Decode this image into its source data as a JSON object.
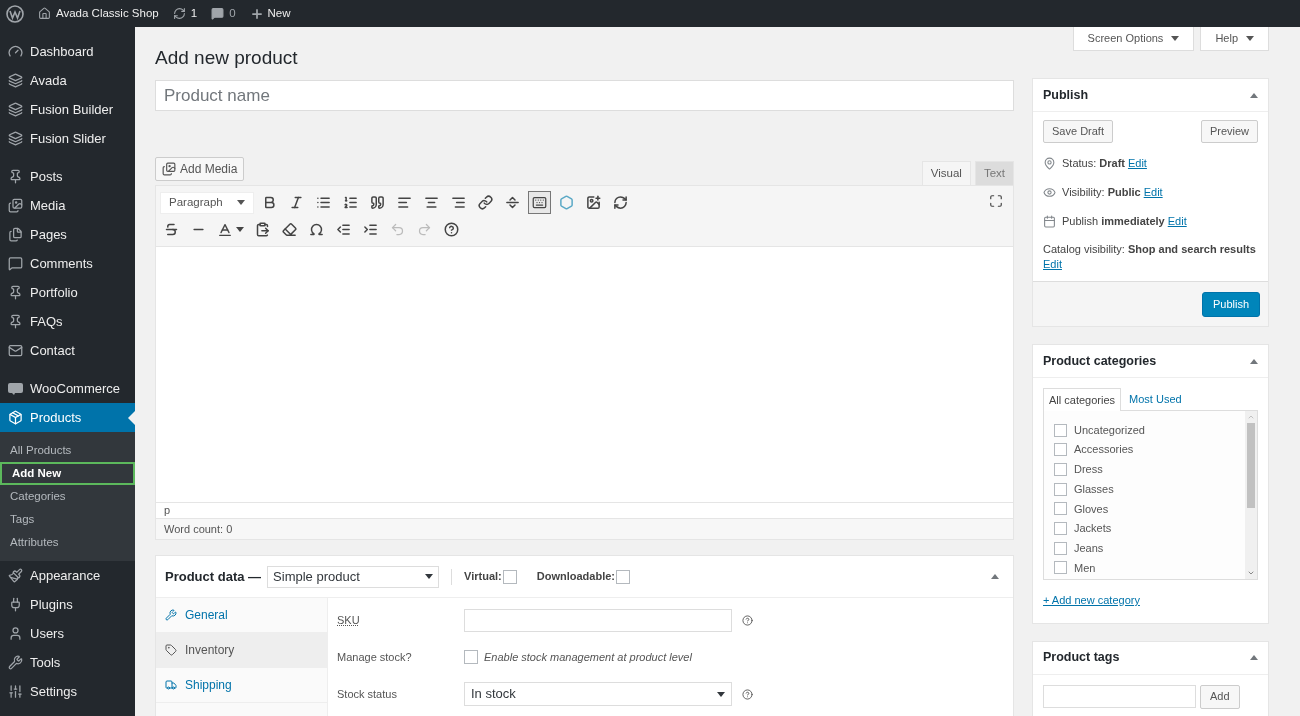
{
  "admin_bar": {
    "site_name": "Avada Classic Shop",
    "updates": "1",
    "comments": "0",
    "new": "New"
  },
  "sidebar": {
    "groups": [
      [
        {
          "label": "Dashboard",
          "selected": false
        },
        {
          "label": "Avada",
          "selected": false
        },
        {
          "label": "Fusion Builder",
          "selected": false
        },
        {
          "label": "Fusion Slider",
          "selected": false
        }
      ],
      [
        {
          "label": "Posts",
          "selected": false
        },
        {
          "label": "Media",
          "selected": false
        },
        {
          "label": "Pages",
          "selected": false
        },
        {
          "label": "Comments",
          "selected": false
        },
        {
          "label": "Portfolio",
          "selected": false
        },
        {
          "label": "FAQs",
          "selected": false
        },
        {
          "label": "Contact",
          "selected": false
        }
      ],
      [
        {
          "label": "WooCommerce",
          "selected": false
        },
        {
          "label": "Products",
          "selected": true,
          "children": [
            {
              "label": "All Products",
              "selected": false
            },
            {
              "label": "Add New",
              "selected": true
            },
            {
              "label": "Categories",
              "selected": false
            },
            {
              "label": "Tags",
              "selected": false
            },
            {
              "label": "Attributes",
              "selected": false
            }
          ]
        },
        {
          "label": "Appearance",
          "selected": false
        },
        {
          "label": "Plugins",
          "selected": false
        },
        {
          "label": "Users",
          "selected": false
        },
        {
          "label": "Tools",
          "selected": false
        },
        {
          "label": "Settings",
          "selected": false
        }
      ]
    ]
  },
  "screen_meta": [
    "Screen Options",
    "Help"
  ],
  "page_title": "Add new product",
  "title_field": {
    "placeholder": "Product name"
  },
  "editor": {
    "add_media": "Add Media",
    "tabs": [
      {
        "label": "Visual",
        "selected": true
      },
      {
        "label": "Text",
        "selected": false
      }
    ],
    "format": "Paragraph",
    "toolbar_toggle_on": true,
    "path": "p",
    "word_count": "Word count: 0"
  },
  "product_data": {
    "title": "Product data —",
    "type": "Simple product",
    "virtual": {
      "label": "Virtual:",
      "checked": false
    },
    "downloadable": {
      "label": "Downloadable:",
      "checked": false
    },
    "tabs": [
      {
        "label": "General",
        "selected": false
      },
      {
        "label": "Inventory",
        "selected": true
      },
      {
        "label": "Shipping",
        "selected": false
      }
    ],
    "fields": [
      {
        "kind": "text",
        "label": "SKU"
      },
      {
        "kind": "checkbox",
        "label": "Manage stock?",
        "description": "Enable stock management at product level",
        "checked": false
      },
      {
        "kind": "select",
        "label": "Stock status",
        "value": "In stock"
      }
    ]
  },
  "publish": {
    "title": "Publish",
    "save_draft": "Save Draft",
    "preview": "Preview",
    "rows": [
      {
        "text": "Status: **Draft**",
        "edit": "Edit"
      },
      {
        "text": "Visibility: **Public**",
        "edit": "Edit"
      },
      {
        "text": "Publish **immediately**",
        "edit": "Edit"
      }
    ],
    "catalog": {
      "text": "Catalog visibility: **Shop and search results**",
      "edit": "Edit"
    },
    "publish_button": "Publish"
  },
  "categories": {
    "title": "Product categories",
    "tabs": [
      {
        "label": "All categories",
        "selected": true
      },
      {
        "label": "Most Used",
        "selected": false
      }
    ],
    "items": [
      {
        "label": "Uncategorized",
        "checked": false
      },
      {
        "label": "Accessories",
        "checked": false
      },
      {
        "label": "Dress",
        "checked": false
      },
      {
        "label": "Glasses",
        "checked": false
      },
      {
        "label": "Gloves",
        "checked": false
      },
      {
        "label": "Jackets",
        "checked": false
      },
      {
        "label": "Jeans",
        "checked": false
      },
      {
        "label": "Men",
        "checked": false
      }
    ],
    "add_link": "+ Add new category"
  },
  "tags": {
    "title": "Product tags",
    "add": "Add"
  }
}
